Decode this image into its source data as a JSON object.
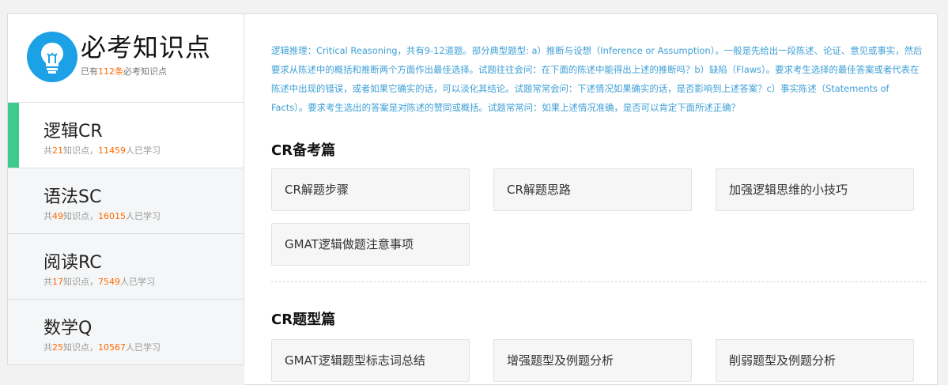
{
  "brand": {
    "title": "必考知识点",
    "sub_prefix": "已有",
    "sub_count": "112条",
    "sub_suffix": "必考知识点"
  },
  "nav": [
    {
      "label": "逻辑CR",
      "stats_a": "共",
      "points": "21",
      "stats_b": "知识点，",
      "learners": "11459",
      "stats_c": "人已学习",
      "active": true
    },
    {
      "label": "语法SC",
      "stats_a": "共",
      "points": "49",
      "stats_b": "知识点，",
      "learners": "16015",
      "stats_c": "人已学习",
      "active": false
    },
    {
      "label": "阅读RC",
      "stats_a": "共",
      "points": "17",
      "stats_b": "知识点，",
      "learners": "7549",
      "stats_c": "人已学习",
      "active": false
    },
    {
      "label": "数学Q",
      "stats_a": "共",
      "points": "25",
      "stats_b": "知识点，",
      "learners": "10567",
      "stats_c": "人已学习",
      "active": false
    }
  ],
  "intro": "逻辑推理：Critical Reasoning，共有9-12道题。部分典型题型: a）推断与设想（Inference or Assumption）。一般是先给出一段陈述、论证、意见或事实，然后要求从陈述中的概括和推断两个方面作出最佳选择。试题往往会问：在下面的陈述中能得出上述的推断吗？b）缺陷（Flaws）。要求考生选择的最佳答案或者代表在陈述中出现的错误，或者如果它确实的话，可以淡化其结论。试题常常会问：下述情况如果确实的话，是否影响到上述答案？c）事实陈述（Statements of Facts）。要求考生选出的答案是对陈述的赞同或概括。试题常常问：如果上述情况准确，是否可以肯定下面所述正确？",
  "sections": [
    {
      "title": "CR备考篇",
      "cards": [
        "CR解题步骤",
        "CR解题思路",
        "加强逻辑思维的小技巧",
        "GMAT逻辑做题注意事项"
      ]
    },
    {
      "title": "CR题型篇",
      "cards": [
        "GMAT逻辑题型标志词总结",
        "增强题型及例题分析",
        "削弱题型及例题分析"
      ]
    }
  ]
}
